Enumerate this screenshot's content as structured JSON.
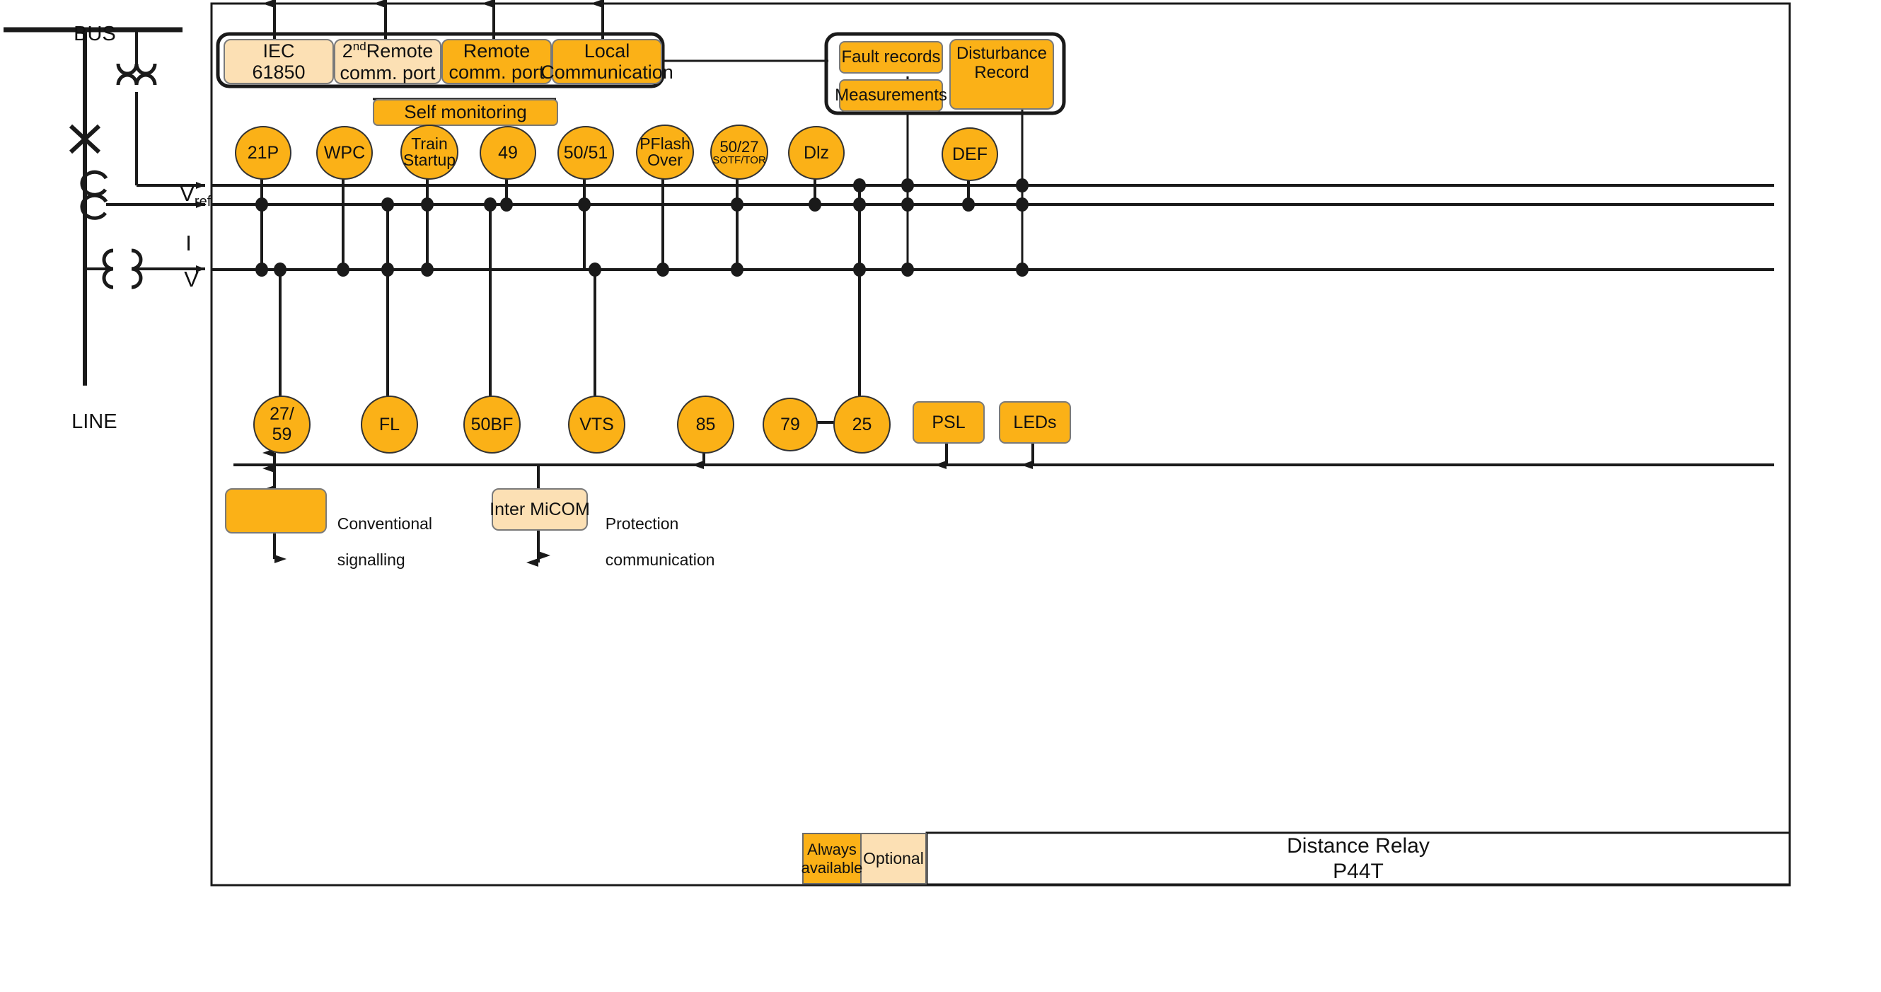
{
  "title_block": {
    "legend_always": "Always\navailable",
    "legend_optional": "Optional",
    "device_name": "Distance Relay\nP44T",
    "device_name_line1": "Distance Relay",
    "device_name_line2": "P44T"
  },
  "power_system": {
    "bus_label": "BUS",
    "line_label": "LINE",
    "breaker_label": "X",
    "signals": [
      {
        "name": "vref",
        "label": "V",
        "sub": "ref"
      },
      {
        "name": "current",
        "label": "I",
        "sub": ""
      },
      {
        "name": "voltage",
        "label": "V",
        "sub": ""
      }
    ]
  },
  "comm_group": {
    "ports": [
      {
        "id": "iec61850",
        "line1": "IEC",
        "line2": "61850",
        "optional": true
      },
      {
        "id": "second-remote-comm-port",
        "line1": "2",
        "sup": "nd",
        "line1b": "Remote",
        "line2": "comm. port",
        "optional": true
      },
      {
        "id": "remote-comm-port",
        "line1": "Remote",
        "line2": "comm. port",
        "optional": false
      },
      {
        "id": "local-communication",
        "line1": "Local",
        "line2": "Communication",
        "optional": false
      }
    ]
  },
  "self_monitoring": {
    "label": "Self monitoring"
  },
  "records_group": {
    "fault_records": "Fault records",
    "measurements": "Measurements",
    "disturbance_record_line1": "Disturbance",
    "disturbance_record_line2": "Record"
  },
  "protection_functions_top": [
    {
      "id": "21P",
      "line1": "21P",
      "line2": "",
      "small": ""
    },
    {
      "id": "WPC",
      "line1": "WPC",
      "line2": "",
      "small": ""
    },
    {
      "id": "train-startup",
      "line1": "Train",
      "line2": "Startup",
      "small": ""
    },
    {
      "id": "49",
      "line1": "49",
      "line2": "",
      "small": ""
    },
    {
      "id": "50-51",
      "line1": "50/51",
      "line2": "",
      "small": ""
    },
    {
      "id": "pflash-over",
      "line1": "PFlash",
      "line2": "Over",
      "small": ""
    },
    {
      "id": "50-27-sotf-tor",
      "line1": "50/27",
      "line2": "",
      "small": "SOTF/TOR"
    },
    {
      "id": "Dlz",
      "line1": "Dlz",
      "line2": "",
      "small": ""
    },
    {
      "id": "DEF",
      "line1": "DEF",
      "line2": "",
      "small": ""
    }
  ],
  "protection_functions_bottom": [
    {
      "id": "27-59",
      "line1": "27/",
      "line2": "59"
    },
    {
      "id": "FL",
      "line1": "FL",
      "line2": ""
    },
    {
      "id": "50BF",
      "line1": "50BF",
      "line2": ""
    },
    {
      "id": "VTS",
      "line1": "VTS",
      "line2": ""
    },
    {
      "id": "85",
      "line1": "85",
      "line2": ""
    },
    {
      "id": "79",
      "line1": "79",
      "line2": ""
    },
    {
      "id": "25",
      "line1": "25",
      "line2": ""
    }
  ],
  "output_blocks": [
    {
      "id": "PSL",
      "label": "PSL"
    },
    {
      "id": "LEDs",
      "label": "LEDs"
    }
  ],
  "io_row": {
    "conventional_signalling_line1": "Conventional",
    "conventional_signalling_line2": "signalling",
    "inter_micom": "Inter MiCOM",
    "protection_comm_line1": "Protection",
    "protection_comm_line2": "communication"
  },
  "colors": {
    "always_available": "#FBB117",
    "optional": "#FCE0B4",
    "stroke": "#1a1a1a",
    "background": "#FFFFFF",
    "waveform": "#8a86c8"
  }
}
